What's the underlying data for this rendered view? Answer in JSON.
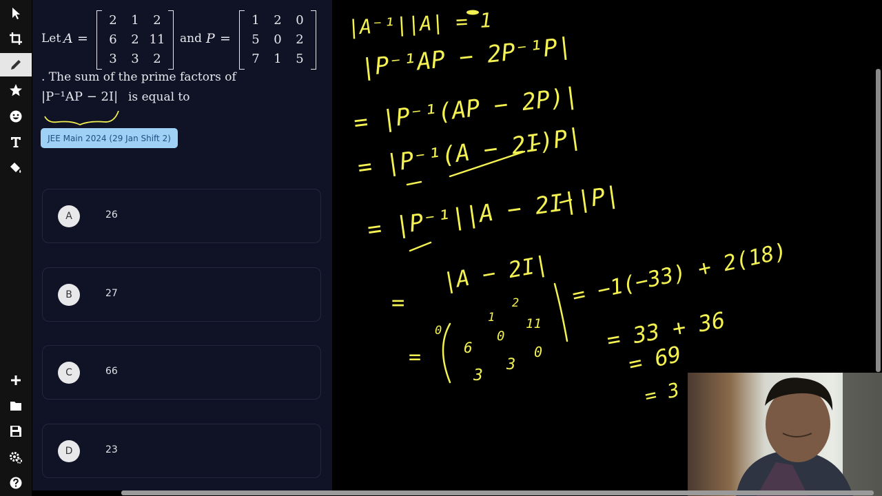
{
  "question": {
    "let_text": "Let",
    "var_a": "A",
    "equals": "=",
    "and_text": "and",
    "var_p": "P",
    "matrix_a": [
      "2",
      "1",
      "2",
      "6",
      "2",
      "11",
      "3",
      "3",
      "2"
    ],
    "matrix_p": [
      "1",
      "2",
      "0",
      "5",
      "0",
      "2",
      "7",
      "1",
      "5"
    ],
    "line2": ". The sum of the prime factors of",
    "expr": "|P⁻¹AP − 2I|",
    "line3_suffix": "is equal to",
    "tag": "JEE Main 2024 (29 Jan Shift 2)"
  },
  "options": [
    {
      "letter": "A",
      "value": "26"
    },
    {
      "letter": "B",
      "value": "27"
    },
    {
      "letter": "C",
      "value": "66"
    },
    {
      "letter": "D",
      "value": "23"
    }
  ],
  "board": {
    "ink_color": "#f4f252",
    "lines": [
      "|A⁻¹||A| = 1",
      "|P⁻¹AP − 2P⁻¹P|",
      "= |P⁻¹(AP − 2P)|",
      "= |P⁻¹(A − 2I)P|",
      "= |P⁻¹||A − 2I||P|",
      "|A − 2I|",
      "=",
      "= −1(−33) + 2(18)",
      "= 33 + 36",
      "= 69",
      "= 3"
    ],
    "det_matrix": [
      "0",
      "1",
      "2",
      "6",
      "0",
      "11",
      "3",
      "3",
      "0"
    ]
  },
  "colors": {
    "panel_bg": "#0f1325",
    "toolbar_bg": "#121212",
    "tag_bg": "#9fd0f5",
    "tag_text": "#1d4f80"
  },
  "icons": [
    "pointer-icon",
    "crop-icon",
    "pencil-icon",
    "star-icon",
    "smiley-icon",
    "text-icon",
    "paint-bucket-icon",
    "plus-icon",
    "folder-icon",
    "save-icon",
    "settings-icon",
    "help-icon"
  ]
}
